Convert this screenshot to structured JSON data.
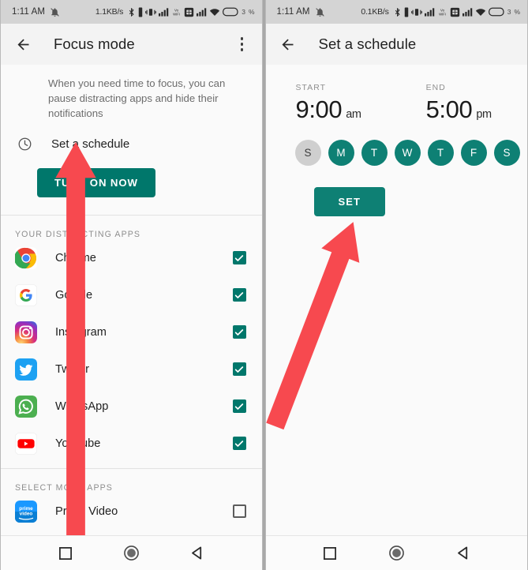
{
  "left_phone": {
    "status_bar": {
      "time": "1:11 AM",
      "mute_icon": "mute-bell-icon",
      "net_speed": "1.1KB/s",
      "icons": [
        "bluetooth-icon",
        "vibrate-icon",
        "vibrate-mode-icon",
        "signal-bars-icon",
        "vowifi-icon",
        "sim-card-icon",
        "signal-bars-2-icon",
        "wifi-icon",
        "battery-icon"
      ],
      "battery_percent": "3"
    },
    "appbar": {
      "back_icon": "back-arrow-icon",
      "title": "Focus mode",
      "overflow_icon": "more-vertical-icon"
    },
    "description": "When you need time to focus, you can pause distracting apps and hide their notifications",
    "schedule": {
      "icon": "clock-icon",
      "label": "Set a schedule"
    },
    "turn_on_button": "TURN ON NOW",
    "sections": [
      {
        "header": "YOUR DISTRACTING APPS",
        "apps": [
          {
            "name": "Chrome",
            "icon": "chrome-icon",
            "checked": true
          },
          {
            "name": "Google",
            "icon": "google-icon",
            "checked": true
          },
          {
            "name": "Instagram",
            "icon": "instagram-icon",
            "checked": true
          },
          {
            "name": "Twitter",
            "icon": "twitter-icon",
            "checked": true
          },
          {
            "name": "WhatsApp",
            "icon": "whatsapp-icon",
            "checked": true
          },
          {
            "name": "YouTube",
            "icon": "youtube-icon",
            "checked": true
          }
        ]
      },
      {
        "header": "SELECT MORE APPS",
        "apps": [
          {
            "name": "Prime Video",
            "icon": "prime-video-icon",
            "checked": false
          }
        ]
      }
    ],
    "nav_bar": [
      "recents-square-icon",
      "home-circle-icon",
      "back-triangle-icon"
    ]
  },
  "right_phone": {
    "status_bar": {
      "time": "1:11 AM",
      "mute_icon": "mute-bell-icon",
      "net_speed": "0.1KB/s",
      "battery_percent": "3"
    },
    "appbar": {
      "back_icon": "back-arrow-icon",
      "title": "Set a schedule"
    },
    "start": {
      "caption": "START",
      "time": "9:00",
      "ampm": "am"
    },
    "end": {
      "caption": "END",
      "time": "5:00",
      "ampm": "pm"
    },
    "days": [
      {
        "label": "S",
        "selected": false
      },
      {
        "label": "M",
        "selected": true
      },
      {
        "label": "T",
        "selected": true
      },
      {
        "label": "W",
        "selected": true
      },
      {
        "label": "T",
        "selected": true
      },
      {
        "label": "F",
        "selected": true
      },
      {
        "label": "S",
        "selected": true
      }
    ],
    "set_button": "SET",
    "nav_bar": [
      "recents-square-icon",
      "home-circle-icon",
      "back-triangle-icon"
    ]
  },
  "annotations": {
    "arrow_color": "#F7494F",
    "left_arrow": "points-up-to-set-a-schedule",
    "right_arrow": "points-up-to-set-button"
  },
  "colors": {
    "teal": "#00776B",
    "teal_day": "#0E8074",
    "arrow_red": "#F7494F",
    "status_bar_bg": "#d4d4d4"
  }
}
